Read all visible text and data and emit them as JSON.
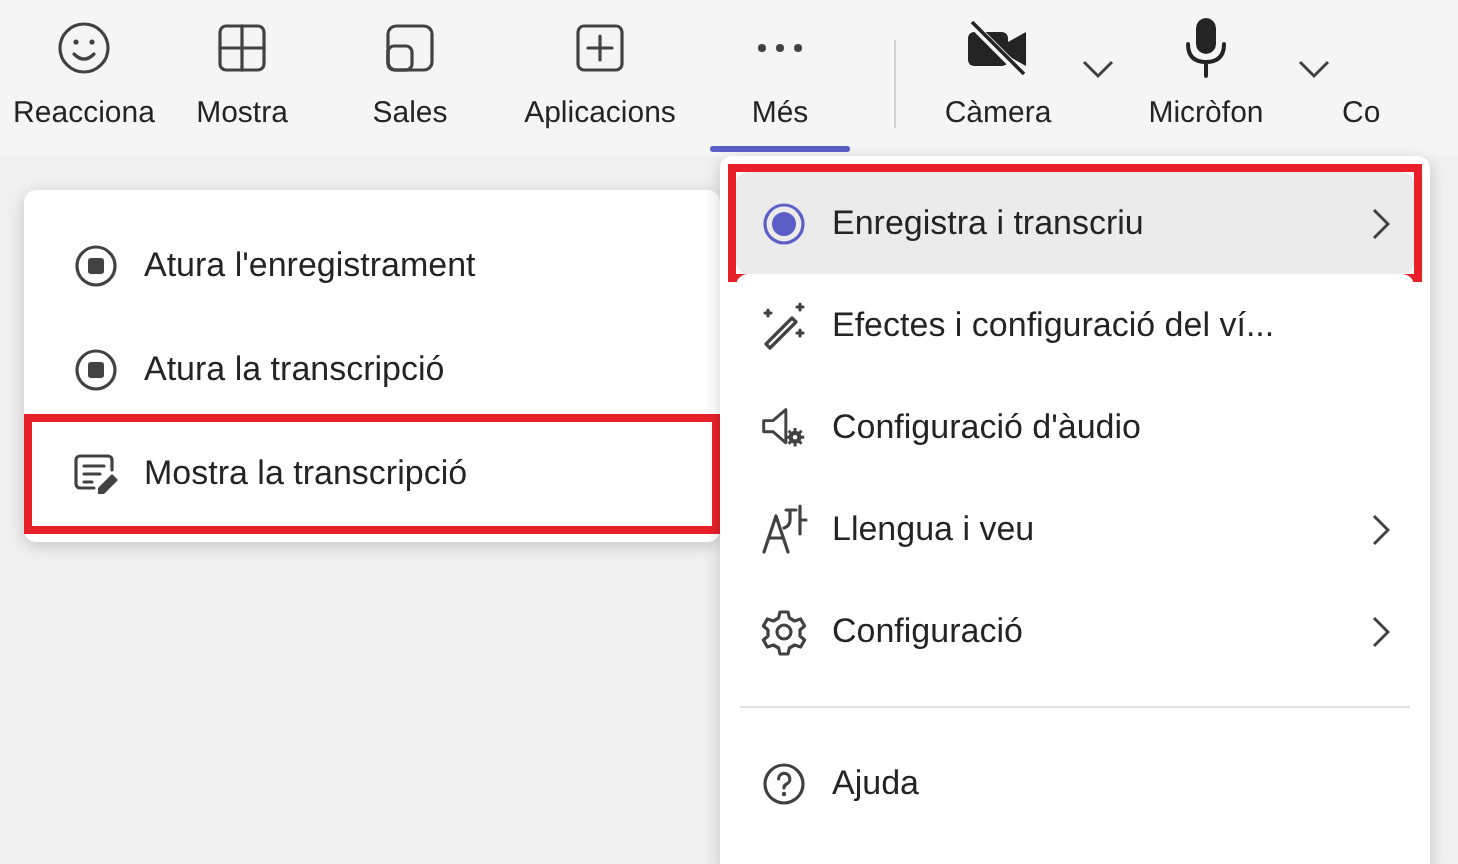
{
  "toolbar": [
    {
      "label": "Reacciona",
      "kind": "smile",
      "selected": false,
      "dropdown": false
    },
    {
      "label": "Mostra",
      "kind": "grid",
      "selected": false,
      "dropdown": false
    },
    {
      "label": "Sales",
      "kind": "rooms",
      "selected": false,
      "dropdown": false
    },
    {
      "label": "Aplicacions",
      "kind": "plus",
      "selected": false,
      "dropdown": false
    },
    {
      "label": "Més",
      "kind": "dots",
      "selected": true,
      "dropdown": false
    },
    {
      "label": "Càmera",
      "kind": "camera",
      "selected": false,
      "dropdown": true
    },
    {
      "label": "Micròfon",
      "kind": "mic",
      "selected": false,
      "dropdown": true
    },
    {
      "label": "Co",
      "kind": "text",
      "selected": false,
      "dropdown": false
    }
  ],
  "submenu": {
    "items": [
      {
        "label": "Atura l'enregistrament",
        "kind": "stop",
        "highlighted": false
      },
      {
        "label": "Atura la transcripció",
        "kind": "stop",
        "highlighted": false
      },
      {
        "label": "Mostra la transcripció",
        "kind": "transcript",
        "highlighted": true
      }
    ]
  },
  "menu": {
    "items": [
      {
        "label": "Enregistra i transcriu",
        "kind": "record",
        "submenu": true,
        "selected": true,
        "highlighted": true
      },
      {
        "label": "Efectes i configuració del ví...",
        "kind": "wand",
        "submenu": false,
        "selected": false,
        "highlighted": false
      },
      {
        "label": "Configuració d'àudio",
        "kind": "speaker",
        "submenu": false,
        "selected": false,
        "highlighted": false
      },
      {
        "label": "Llengua i veu",
        "kind": "language",
        "submenu": true,
        "selected": false,
        "highlighted": false
      },
      {
        "label": "Configuració",
        "kind": "gear",
        "submenu": true,
        "selected": false,
        "highlighted": false
      },
      {
        "kind": "divider"
      },
      {
        "label": "Ajuda",
        "kind": "help",
        "submenu": false,
        "selected": false,
        "highlighted": false
      }
    ]
  }
}
